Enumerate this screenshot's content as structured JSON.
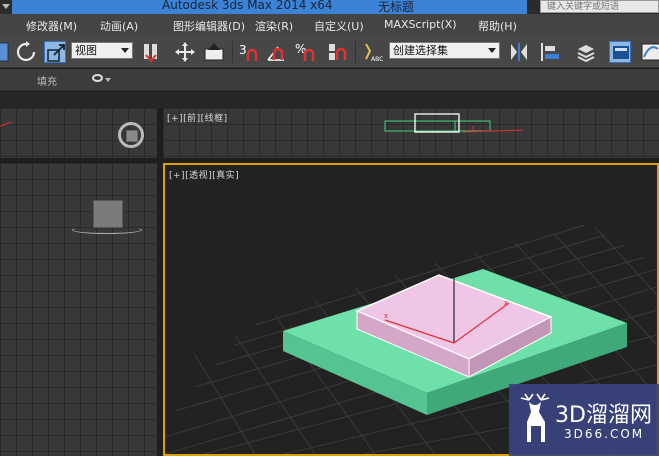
{
  "titlebar": {
    "app_title": "Autodesk 3ds Max  2014 x64",
    "doc_title": "无标题",
    "search_placeholder": "键入关键字或短语"
  },
  "menu": {
    "items": [
      "修改器(M)",
      "动画(A)",
      "图形编辑器(D)",
      "渲染(R)",
      "自定义(U)",
      "MAXScript(X)",
      "帮助(H)"
    ]
  },
  "toolbar": {
    "view_dropdown": "视图",
    "selection_set_dropdown": "创建选择集",
    "snap_3": "3",
    "snap_percent": "%"
  },
  "ribbon": {
    "label": "填充"
  },
  "viewports": {
    "top_right_label": "[+][前][线框]",
    "persp_label": "[+][透视][真实]"
  },
  "watermark": {
    "brand": "3D溜溜网",
    "url": "3D66.COM"
  },
  "colors": {
    "title_blue": "#3b83d6",
    "viewport_border": "#e0a000",
    "base_box": "#6fe0a9",
    "top_box": "#f0c6e6"
  }
}
